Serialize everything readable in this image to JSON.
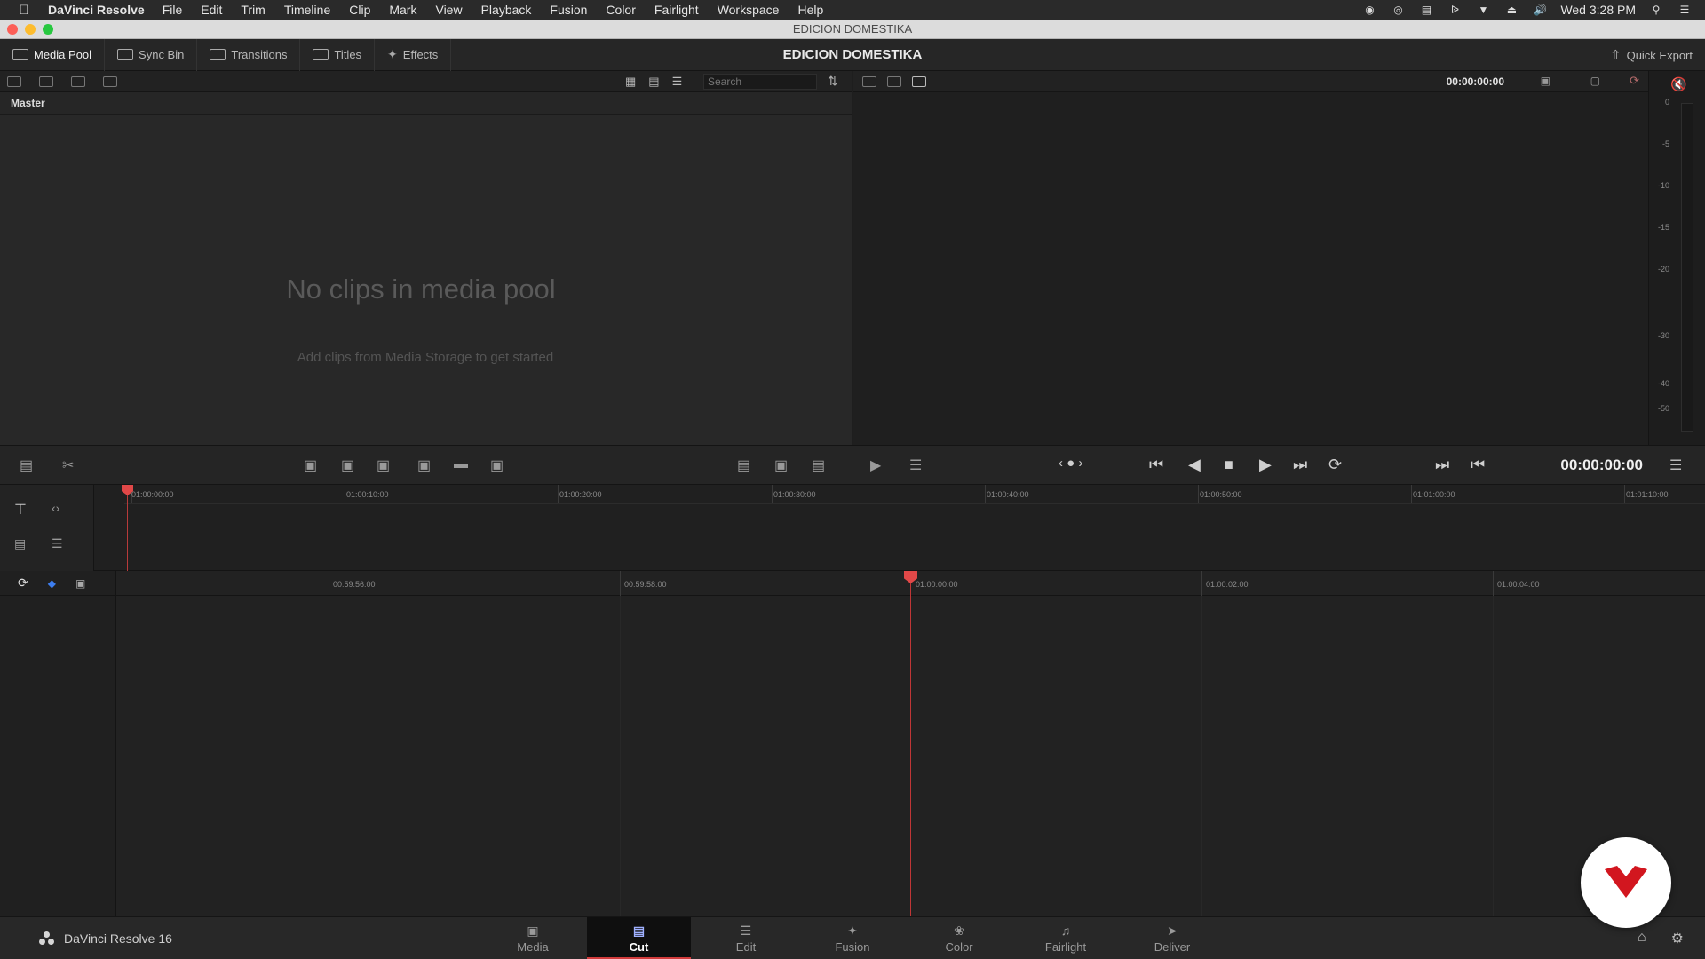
{
  "menubar": {
    "app_name": "DaVinci Resolve",
    "items": [
      "File",
      "Edit",
      "Trim",
      "Timeline",
      "Clip",
      "Mark",
      "View",
      "Playback",
      "Fusion",
      "Color",
      "Fairlight",
      "Workspace",
      "Help"
    ],
    "clock": "Wed 3:28 PM"
  },
  "window": {
    "title": "EDICION DOMESTIKA"
  },
  "toolbar": {
    "media_pool": "Media Pool",
    "sync_bin": "Sync Bin",
    "transitions": "Transitions",
    "titles": "Titles",
    "effects": "Effects",
    "project_title": "EDICION DOMESTIKA",
    "quick_export": "Quick Export"
  },
  "media_pool": {
    "search_placeholder": "Search",
    "bin_name": "Master",
    "empty_title": "No clips in media pool",
    "empty_subtitle": "Add clips from Media Storage to get started"
  },
  "viewer": {
    "timecode": "00:00:00:00",
    "meter_ticks": [
      "0",
      "-5",
      "-10",
      "-15",
      "-20",
      "-30",
      "-40",
      "-50"
    ]
  },
  "transport": {
    "timecode": "00:00:00:00"
  },
  "upper_timeline": {
    "ticks": [
      "01:00:00:00",
      "01:00:10:00",
      "01:00:20:00",
      "01:00:30:00",
      "01:00:40:00",
      "01:00:50:00",
      "01:01:00:00",
      "01:01:10:00"
    ]
  },
  "lower_timeline": {
    "ticks": [
      "00:59:56:00",
      "00:59:58:00",
      "01:00:00:00",
      "01:00:02:00",
      "01:00:04:00"
    ]
  },
  "pagebar": {
    "brand": "DaVinci Resolve 16",
    "tabs": [
      {
        "label": "Media",
        "icon": "media-icon"
      },
      {
        "label": "Cut",
        "icon": "cut-icon",
        "active": true
      },
      {
        "label": "Edit",
        "icon": "edit-icon"
      },
      {
        "label": "Fusion",
        "icon": "fusion-icon"
      },
      {
        "label": "Color",
        "icon": "color-icon"
      },
      {
        "label": "Fairlight",
        "icon": "fairlight-icon"
      },
      {
        "label": "Deliver",
        "icon": "deliver-icon"
      }
    ]
  },
  "colors": {
    "accent": "#e14848",
    "badge_brand": "#d2161f"
  }
}
